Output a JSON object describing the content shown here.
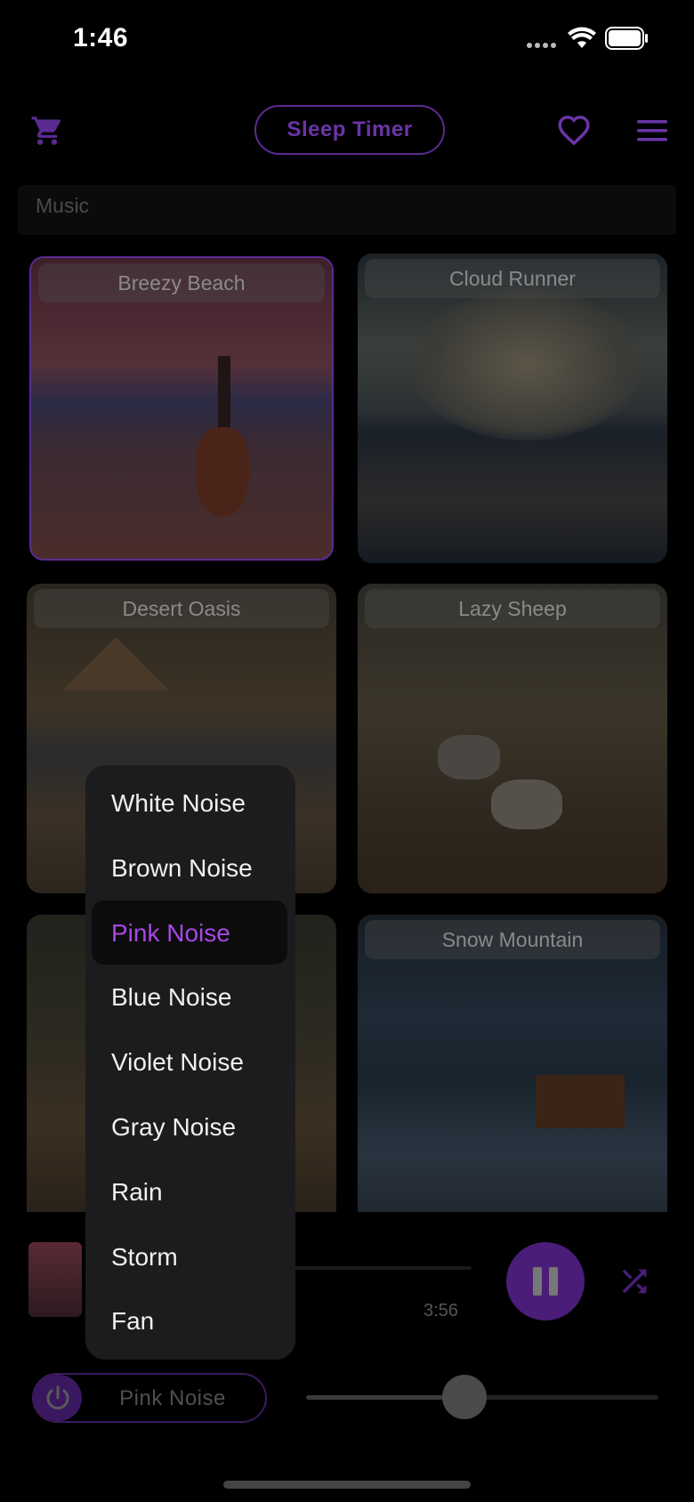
{
  "status_bar": {
    "time": "1:46"
  },
  "header": {
    "cart_icon": "cart-icon",
    "sleep_timer_label": "Sleep Timer",
    "favorite_icon": "heart-icon",
    "menu_icon": "hamburger-icon"
  },
  "section": {
    "label": "Music"
  },
  "tiles": [
    {
      "title": "Breezy Beach",
      "selected": true
    },
    {
      "title": "Cloud Runner"
    },
    {
      "title": "Desert Oasis"
    },
    {
      "title": "Lazy Sheep"
    },
    {
      "title": ""
    },
    {
      "title": "Snow Mountain"
    }
  ],
  "player": {
    "total_time": "3:56",
    "pause_icon": "pause-icon",
    "shuffle_icon": "shuffle-icon"
  },
  "noise": {
    "power_icon": "power-icon",
    "selected": "Pink Noise",
    "volume_fraction": 0.45
  },
  "dropdown": {
    "items": [
      "White Noise",
      "Brown Noise",
      "Pink Noise",
      "Blue Noise",
      "Violet Noise",
      "Gray Noise",
      "Rain",
      "Storm",
      "Fan"
    ],
    "selected_index": 2
  },
  "colors": {
    "accent": "#a648e6",
    "accent_dim": "#5b2a91"
  }
}
